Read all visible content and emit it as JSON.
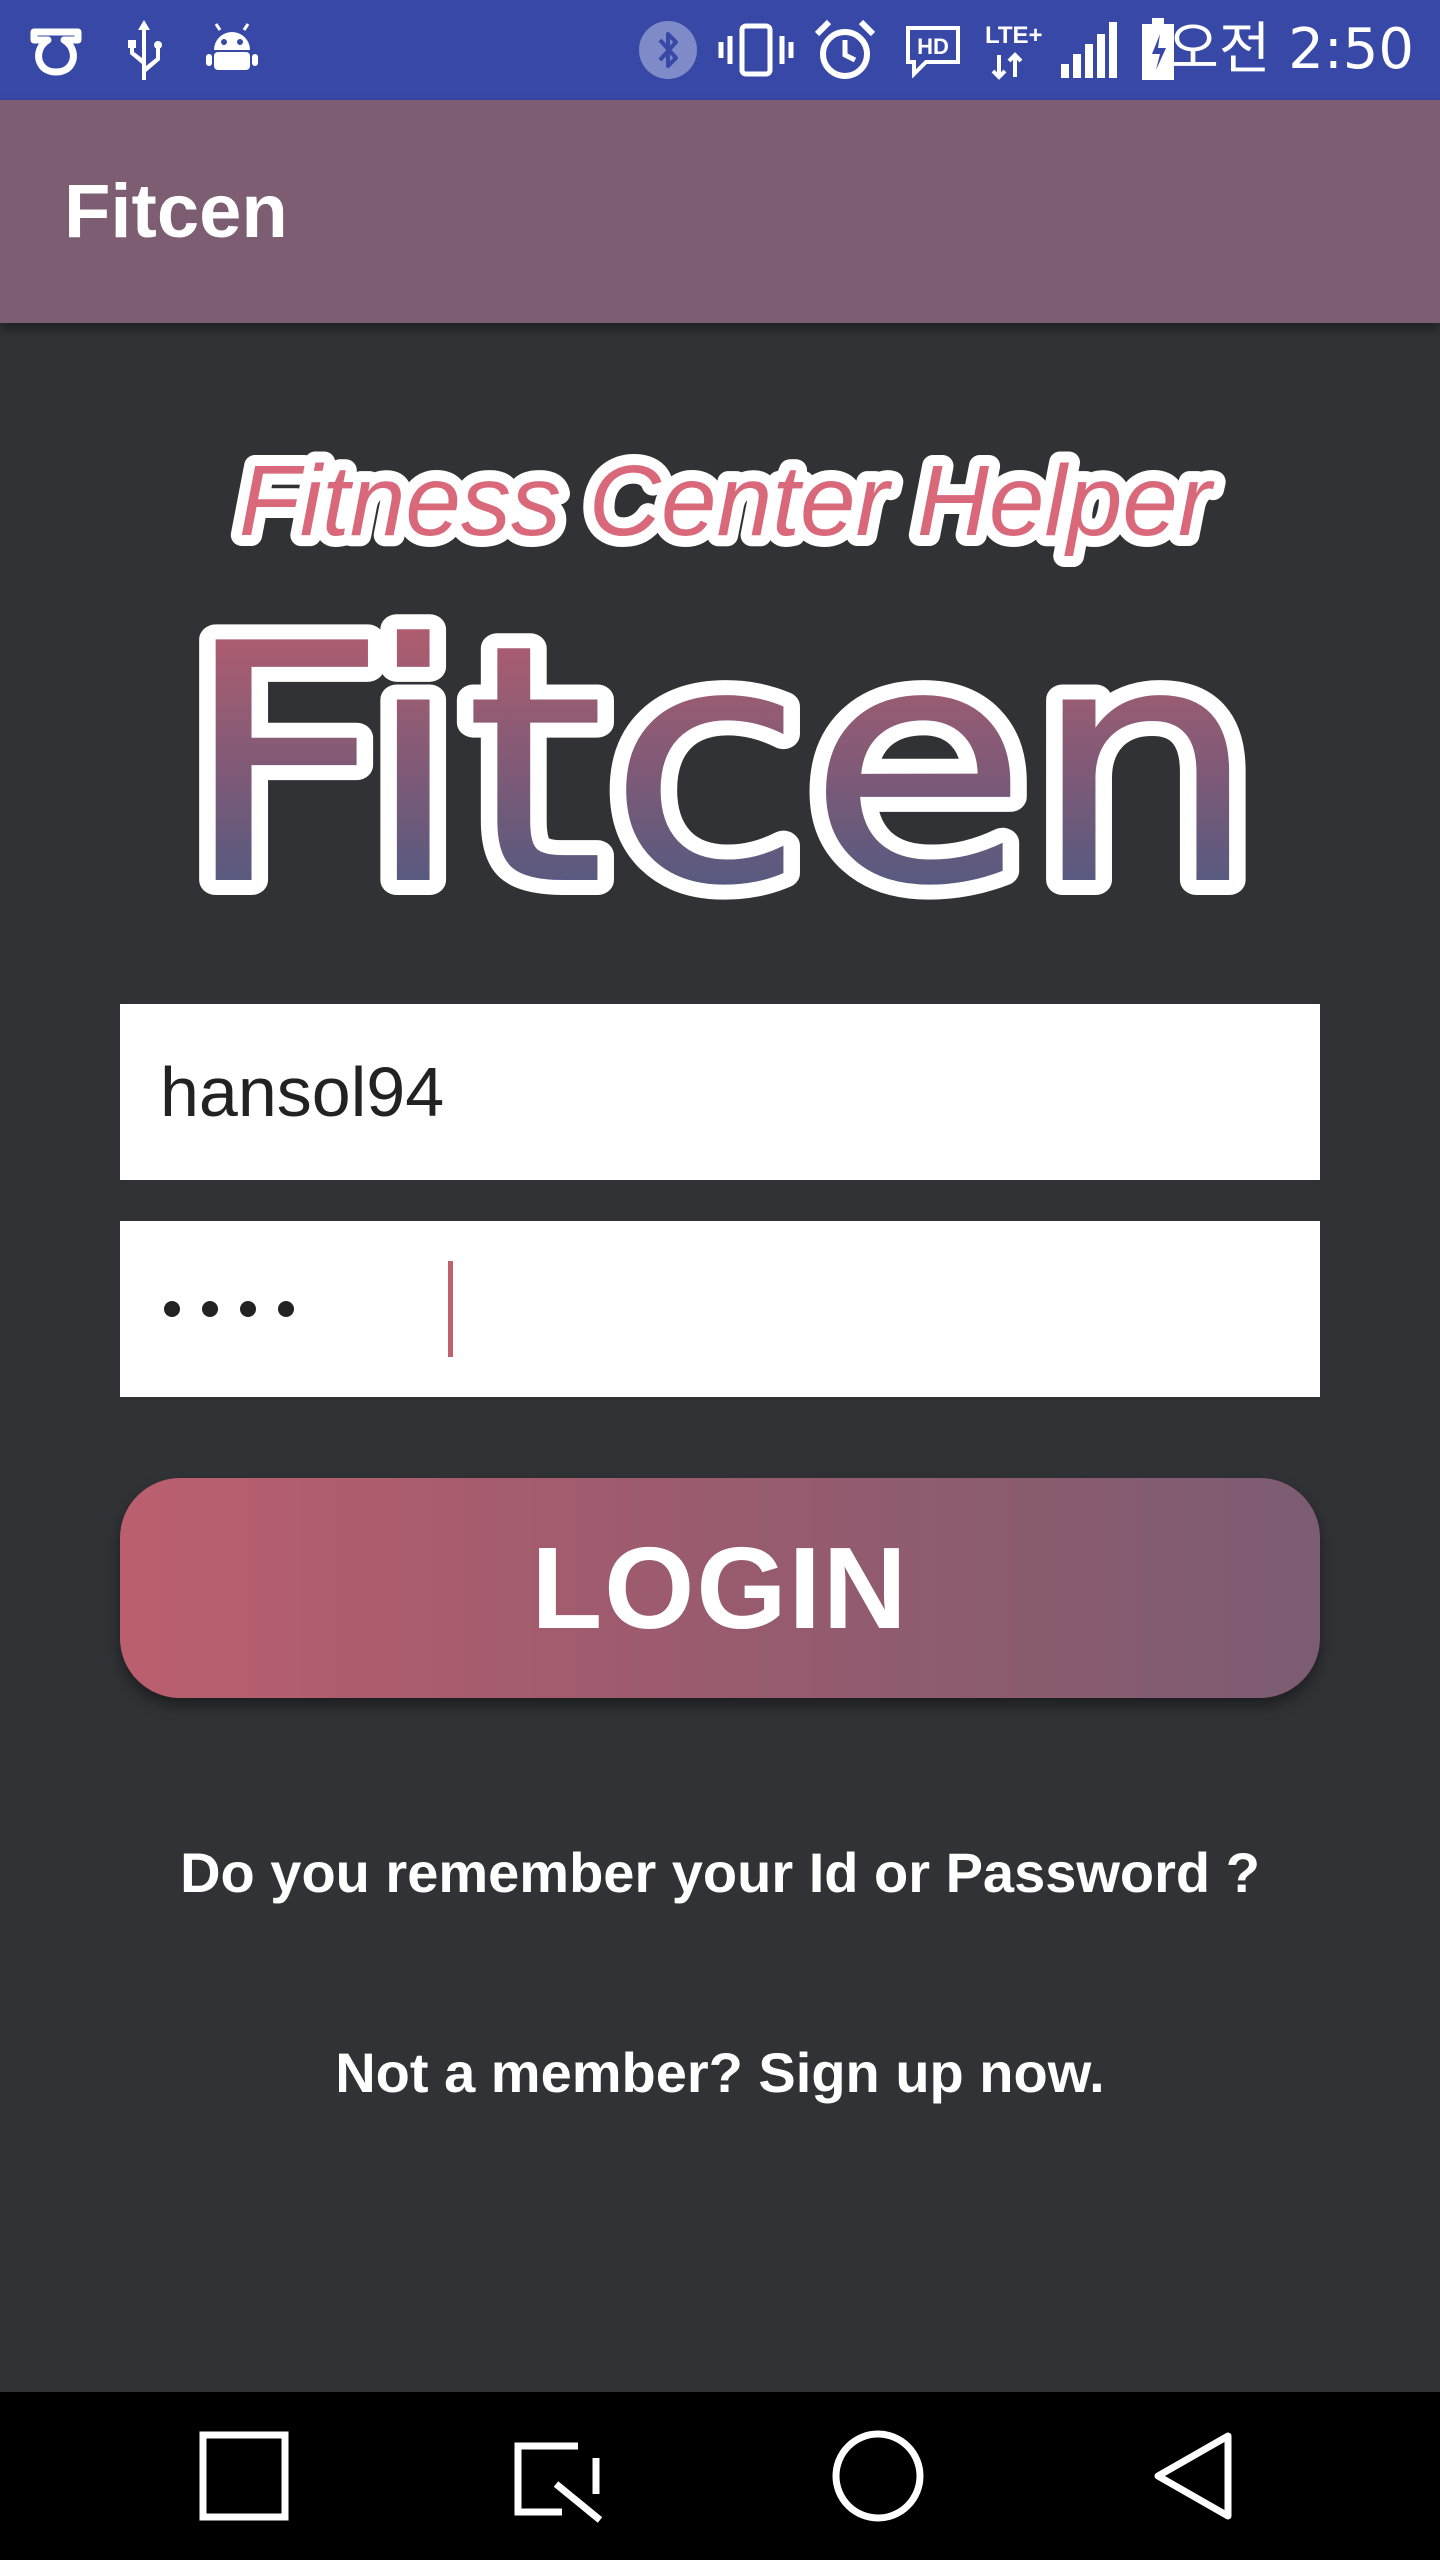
{
  "status_bar": {
    "time": "오전 2:50",
    "icons": [
      "app-notification-icon",
      "usb-icon",
      "android-debug-icon",
      "bluetooth-icon",
      "vibrate-icon",
      "alarm-icon",
      "hd-voice-icon",
      "lte-icon",
      "signal-icon",
      "battery-charging-icon"
    ],
    "hd_label": "HD",
    "lte_label": "LTE+"
  },
  "app_bar": {
    "title": "Fitcen"
  },
  "logo": {
    "tagline": "Fitness Center Helper",
    "wordmark": "Fitcen"
  },
  "login_form": {
    "username_value": "hansol94",
    "password_masked_length": 4,
    "login_label": "LOGIN",
    "forgot_link": "Do you remember your Id or Password ?",
    "signup_link": "Not a member? Sign up now."
  },
  "nav_bar": {
    "buttons": [
      "square-icon",
      "screenshot-edit-icon",
      "home-icon",
      "back-icon"
    ]
  },
  "colors": {
    "status_bar": "#3848a6",
    "app_bar": "#7c5d72",
    "background": "#303236",
    "button_start": "#bb5f6e",
    "button_end": "#7c5c72",
    "caret": "#c0616f"
  }
}
